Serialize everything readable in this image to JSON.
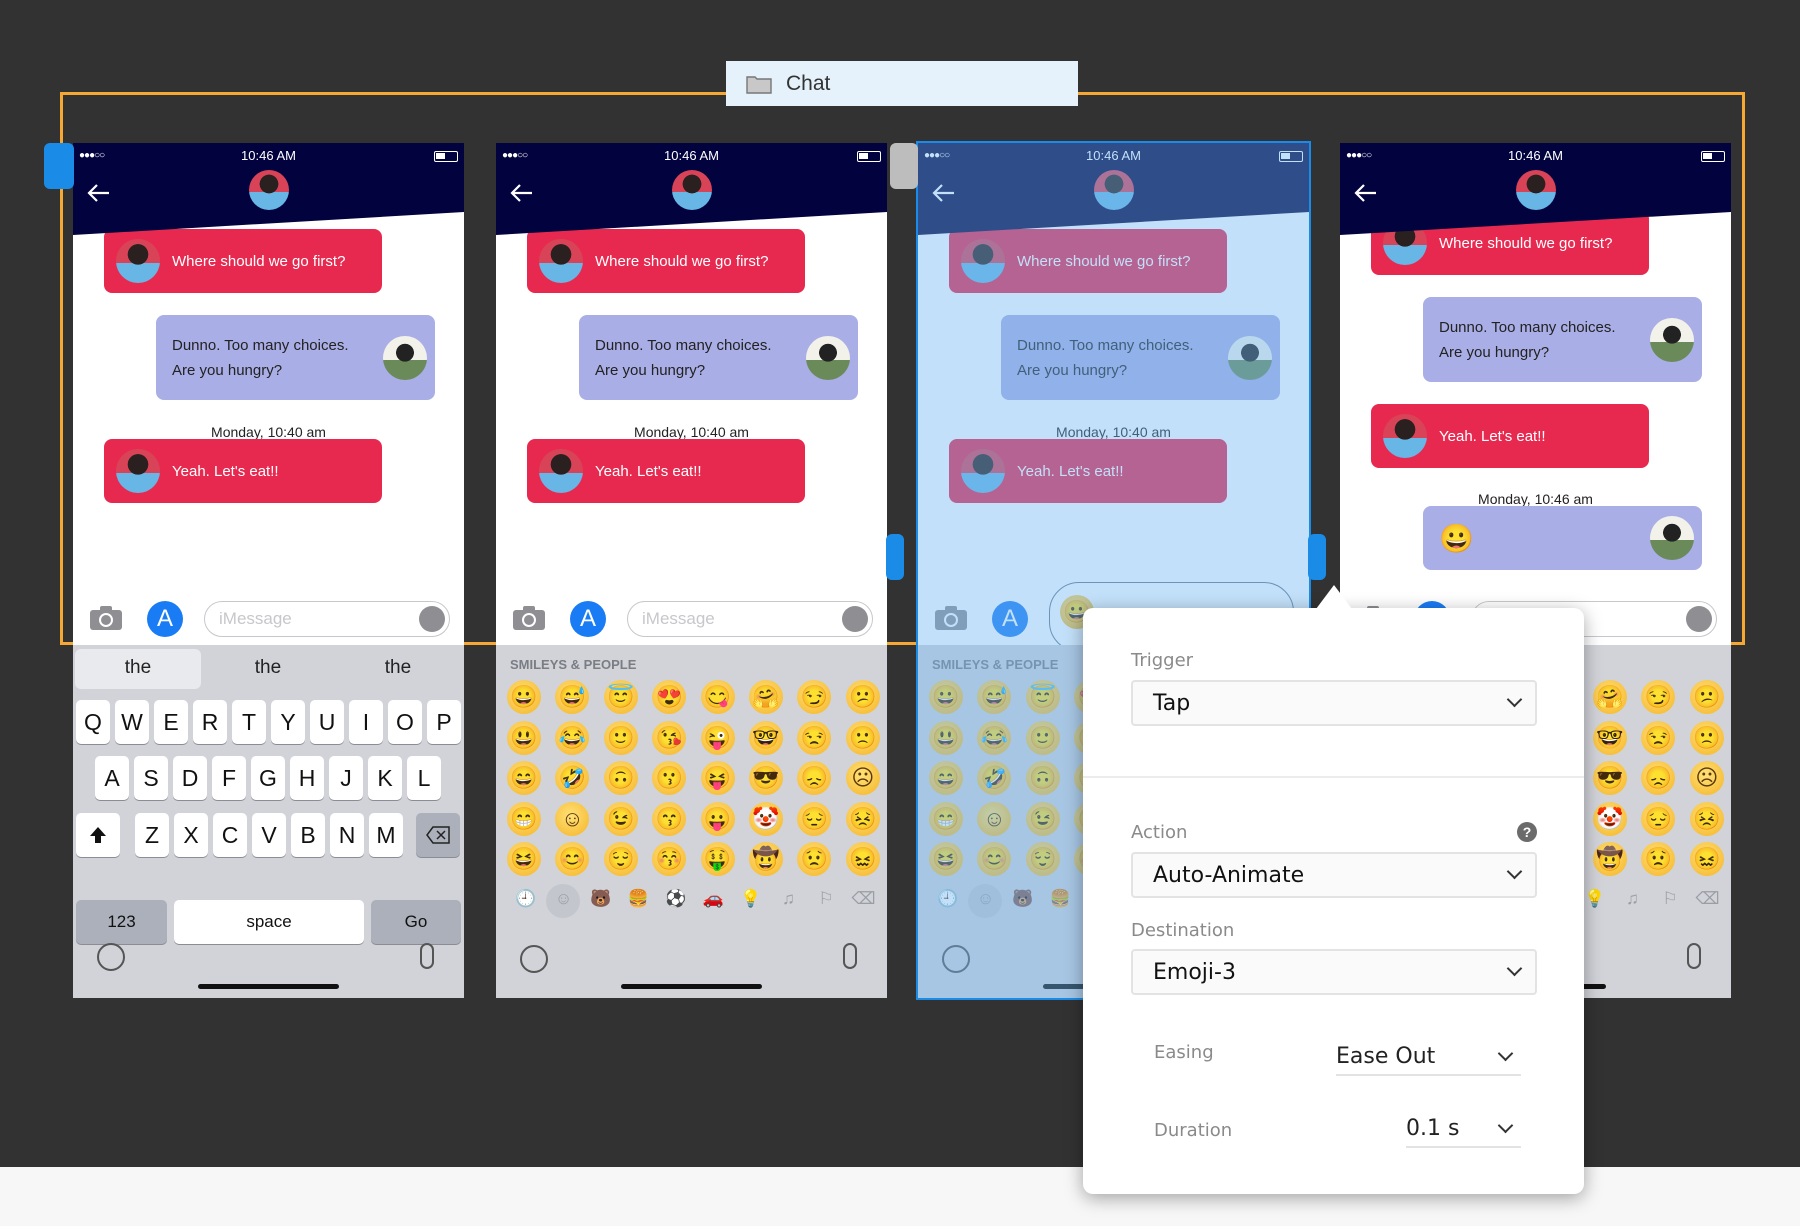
{
  "group_label": {
    "title": "Chat",
    "icon": "folder-icon"
  },
  "colors": {
    "frame": "#f5a833",
    "header": "#02023f",
    "incoming_bubble": "#e8294f",
    "outgoing_bubble": "#aaaee6",
    "selection": "#1a8ce8"
  },
  "status_bar": {
    "signal": "●●●○○",
    "time": "10:46 AM"
  },
  "input": {
    "placeholder": "iMessage"
  },
  "phones": [
    {
      "messages": [
        {
          "side": "left",
          "lines": [
            "Where should we go first?"
          ]
        },
        {
          "side": "right",
          "lines": [
            "Dunno. Too many choices.",
            "Are you hungry?"
          ]
        },
        {
          "side": "date",
          "lines": [
            "Monday, 10:40 am"
          ]
        },
        {
          "side": "left",
          "lines": [
            "Yeah. Let's eat!!"
          ]
        }
      ],
      "keyboard": "letters",
      "selected": false
    },
    {
      "messages": [
        {
          "side": "left",
          "lines": [
            "Where should we go first?"
          ]
        },
        {
          "side": "right",
          "lines": [
            "Dunno. Too many choices.",
            "Are you hungry?"
          ]
        },
        {
          "side": "date",
          "lines": [
            "Monday, 10:40 am"
          ]
        },
        {
          "side": "left",
          "lines": [
            "Yeah. Let's eat!!"
          ]
        }
      ],
      "keyboard": "emoji",
      "selected": false
    },
    {
      "messages": [
        {
          "side": "left",
          "lines": [
            "Where should we go first?"
          ]
        },
        {
          "side": "right",
          "lines": [
            "Dunno. Too many choices.",
            "Are you hungry?"
          ]
        },
        {
          "side": "date",
          "lines": [
            "Monday, 10:40 am"
          ]
        },
        {
          "side": "left",
          "lines": [
            "Yeah. Let's eat!!"
          ]
        }
      ],
      "keyboard": "emoji",
      "selected": true,
      "input_emoji": "😀"
    },
    {
      "messages": [
        {
          "side": "left",
          "lines": [
            "Where should we go first?"
          ]
        },
        {
          "side": "right",
          "lines": [
            "Dunno. Too many choices.",
            "Are you hungry?"
          ]
        },
        {
          "side": "left",
          "lines": [
            "Yeah. Let's eat!!"
          ]
        },
        {
          "side": "date",
          "lines": [
            "Monday, 10:46 am"
          ]
        },
        {
          "side": "right",
          "lines": [
            "😀"
          ]
        }
      ],
      "keyboard": "emoji",
      "selected": false
    }
  ],
  "keyboard": {
    "suggestions": [
      "the",
      "the",
      "the"
    ],
    "rows": [
      [
        "Q",
        "W",
        "E",
        "R",
        "T",
        "Y",
        "U",
        "I",
        "O",
        "P"
      ],
      [
        "A",
        "S",
        "D",
        "F",
        "G",
        "H",
        "J",
        "K",
        "L"
      ],
      [
        "Z",
        "X",
        "C",
        "V",
        "B",
        "N",
        "M"
      ]
    ],
    "numbers_key": "123",
    "space_key": "space",
    "go_key": "Go"
  },
  "emoji_keyboard": {
    "section_title": "SMILEYS & PEOPLE",
    "grid": [
      [
        "😀",
        "😅",
        "😇",
        "😍",
        "😋",
        "🤗",
        "😏",
        "😕"
      ],
      [
        "😃",
        "😂",
        "🙂",
        "😘",
        "😜",
        "🤓",
        "😒",
        "🙁"
      ],
      [
        "😄",
        "🤣",
        "🙃",
        "😗",
        "😝",
        "😎",
        "😞",
        "☹"
      ],
      [
        "😁",
        "☺",
        "😉",
        "😙",
        "😛",
        "🤡",
        "😔",
        "😣"
      ],
      [
        "😆",
        "😊",
        "😌",
        "😚",
        "🤑",
        "🤠",
        "😟",
        "😖"
      ]
    ],
    "categories": [
      "🕘",
      "☺",
      "🐻",
      "🍔",
      "⚽",
      "🚗",
      "💡",
      "♫",
      "⚐",
      "⌫"
    ]
  },
  "interaction": {
    "trigger_label": "Trigger",
    "trigger_value": "Tap",
    "action_label": "Action",
    "action_value": "Auto-Animate",
    "destination_label": "Destination",
    "destination_value": "Emoji-3",
    "easing_label": "Easing",
    "easing_value": "Ease Out",
    "duration_label": "Duration",
    "duration_value": "0.1 s"
  }
}
